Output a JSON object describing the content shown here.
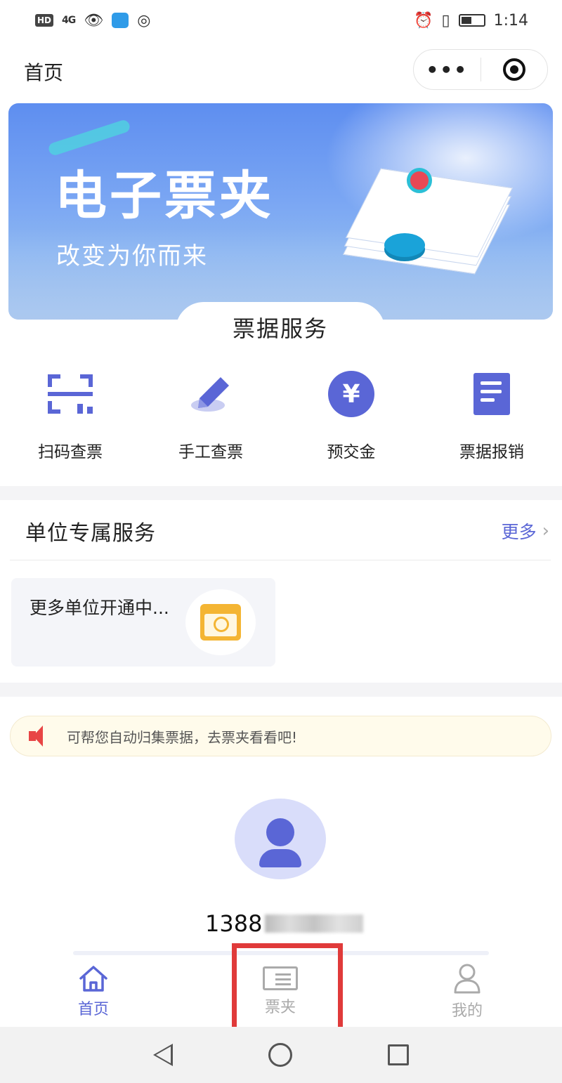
{
  "status_bar": {
    "hd": "HD",
    "signal": "4G",
    "time": "1:14"
  },
  "nav": {
    "title": "首页",
    "menu_dots": "•••"
  },
  "banner": {
    "title": "电子票夹",
    "subtitle": "改变为你而来"
  },
  "services": {
    "title": "票据服务",
    "items": [
      {
        "label": "扫码查票",
        "icon": "scan-icon"
      },
      {
        "label": "手工查票",
        "icon": "pen-icon"
      },
      {
        "label": "预交金",
        "icon": "yuan-icon",
        "glyph": "¥"
      },
      {
        "label": "票据报销",
        "icon": "receipt-icon"
      }
    ]
  },
  "unit": {
    "title": "单位专属服务",
    "more": "更多",
    "card_text": "更多单位开通中..."
  },
  "notice": {
    "text": "可帮您自动归集票据，去票夹看看吧!"
  },
  "user": {
    "phone_visible": "1388"
  },
  "tabbar": {
    "items": [
      {
        "label": "首页",
        "icon": "home-icon",
        "active": true
      },
      {
        "label": "票夹",
        "icon": "ticket-icon",
        "active": false
      },
      {
        "label": "我的",
        "icon": "user-icon",
        "active": false
      }
    ]
  },
  "colors": {
    "accent": "#5a66d6",
    "highlight": "#e03a3a",
    "notice_bg": "#fffbeb"
  }
}
